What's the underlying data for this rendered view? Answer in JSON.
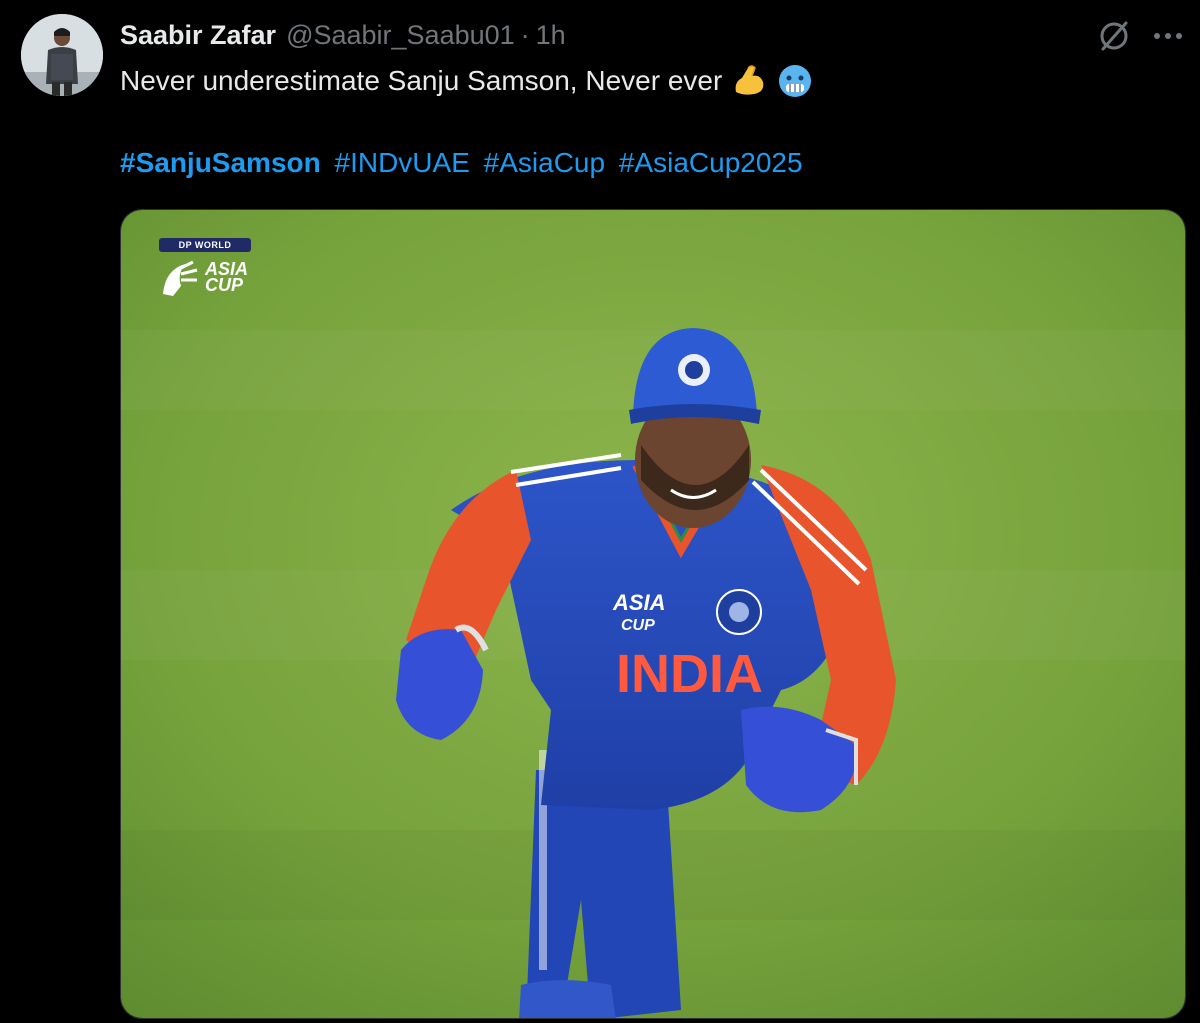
{
  "post": {
    "author": {
      "display_name": "Saabir Zafar",
      "handle": "@Saabir_Saabu01",
      "separator": "·",
      "time": "1h"
    },
    "text": "Never underestimate Sanju Samson, Never ever",
    "emojis": [
      "flexed-biceps",
      "cold-face"
    ],
    "hashtags": [
      "#SanjuSamson",
      "#INDvUAE",
      "#AsiaCup",
      "#AsiaCup2025"
    ],
    "media": {
      "logo_sponsor": "DP WORLD",
      "logo_line1": "ASIA",
      "logo_line2": "CUP",
      "jersey_text": "INDIA",
      "jersey_badge_line1": "ASIA",
      "jersey_badge_line2": "CUP"
    },
    "icons": [
      "grok-icon",
      "more-icon"
    ]
  },
  "colors": {
    "background": "#000000",
    "text": "#e7e9ea",
    "secondary_text": "#71767b",
    "link": "#1d9bf0"
  }
}
